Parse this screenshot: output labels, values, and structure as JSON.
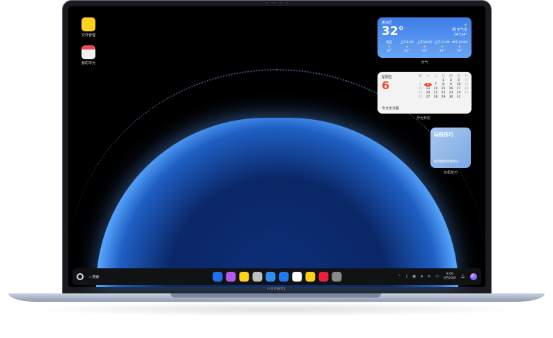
{
  "desktop_icons": [
    {
      "label": "文件管理",
      "color": "#ffd21f"
    },
    {
      "label": "我的华为",
      "color": "#f0f0f0"
    }
  ],
  "weather": {
    "location": "香洲区",
    "temp": "32°",
    "condition": "晴 空气优",
    "range": "34°/24°",
    "label": "天气",
    "forecast": [
      {
        "time": "现在",
        "temp": "32°"
      },
      {
        "time": "上午9:00",
        "temp": "32°"
      },
      {
        "time": "上午10:00",
        "temp": "33°"
      },
      {
        "time": "上午11:00",
        "temp": "33°"
      },
      {
        "time": "中午12:00",
        "temp": "34°"
      }
    ]
  },
  "calendar": {
    "weekday": "星期五",
    "day": "6",
    "no_events": "今日无日程",
    "label": "华为日历",
    "headers": [
      "日",
      "一",
      "二",
      "三",
      "四",
      "五",
      "六"
    ],
    "days": [
      "",
      "",
      "",
      "1",
      "2",
      "3",
      "4",
      "5",
      "6",
      "7",
      "8",
      "9",
      "10",
      "11",
      "12",
      "13",
      "14",
      "15",
      "16",
      "17",
      "18",
      "19",
      "20",
      "21",
      "22",
      "23",
      "24",
      "25",
      "26",
      "27",
      "28",
      "29",
      "30",
      "31",
      ""
    ],
    "today": "6"
  },
  "tips": {
    "title": "玩机技巧",
    "subtitle": "如何使用控制中心",
    "label": "玩机技巧"
  },
  "taskbar": {
    "search_label": "搜索",
    "time": "8:08",
    "date": "6月20日",
    "dock": [
      {
        "name": "app-launcher",
        "color": "#1f6ff2"
      },
      {
        "name": "gallery-folder",
        "color": "#b05cf0"
      },
      {
        "name": "notes",
        "color": "#ffd21f"
      },
      {
        "name": "recycle-bin",
        "color": "#bfbfbf"
      },
      {
        "name": "browser",
        "color": "#2f8df5"
      },
      {
        "name": "mail",
        "color": "#1f7af0"
      },
      {
        "name": "photos",
        "color": "#ffffff"
      },
      {
        "name": "card",
        "color": "#ffd21f"
      },
      {
        "name": "app-gallery",
        "color": "#e8203d"
      },
      {
        "name": "settings",
        "color": "#8a8a8a"
      }
    ]
  },
  "brand": "HUAWEI"
}
